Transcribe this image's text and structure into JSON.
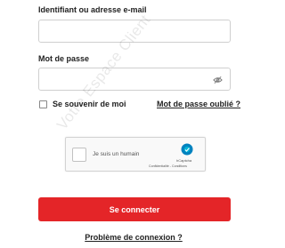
{
  "login": {
    "identifier_label": "Identifiant ou adresse e-mail",
    "identifier_value": "",
    "password_label": "Mot de passe",
    "password_value": "",
    "remember_label": "Se souvenir de moi",
    "remember_checked": false,
    "forgot_link": "Mot de passe oublié ?",
    "submit_label": "Se connecter",
    "trouble_link": "Problème de connexion ?"
  },
  "captcha": {
    "label": "Je suis un humain",
    "brand": "hCaptcha",
    "links": "Confidentialité - Conditions",
    "logo_icon": "hcaptcha-logo-icon"
  },
  "watermark": "Votre Espace Client",
  "colors": {
    "primary": "#e42528",
    "text": "#222222",
    "border": "#cfcfcf"
  }
}
